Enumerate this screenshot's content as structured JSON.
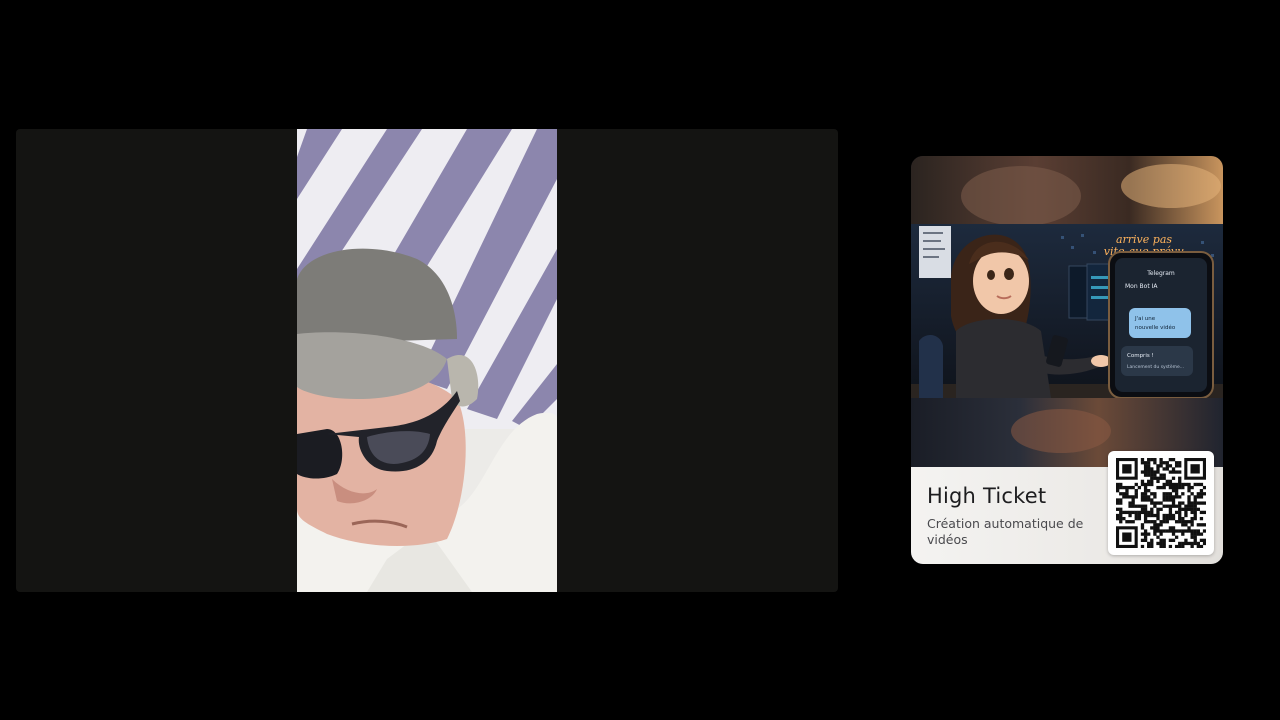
{
  "promo_card": {
    "title": "High Ticket",
    "subtitle": "Création automatique de vidéos",
    "image_sign_text": "arrive pas vite que prévu",
    "phone_app": "Telegram",
    "phone_chat": "Mon Bot IA",
    "phone_bubble_1": "J'ai une nouvelle vidéo",
    "phone_bubble_2": "Compris !",
    "phone_bubble_3": "Lancement du système..."
  },
  "colors": {
    "stage_bg": "#141412",
    "page_bg": "#000000",
    "card_footer_bg": "#f1f0ee",
    "awning_stripe": "#8a82aa"
  }
}
